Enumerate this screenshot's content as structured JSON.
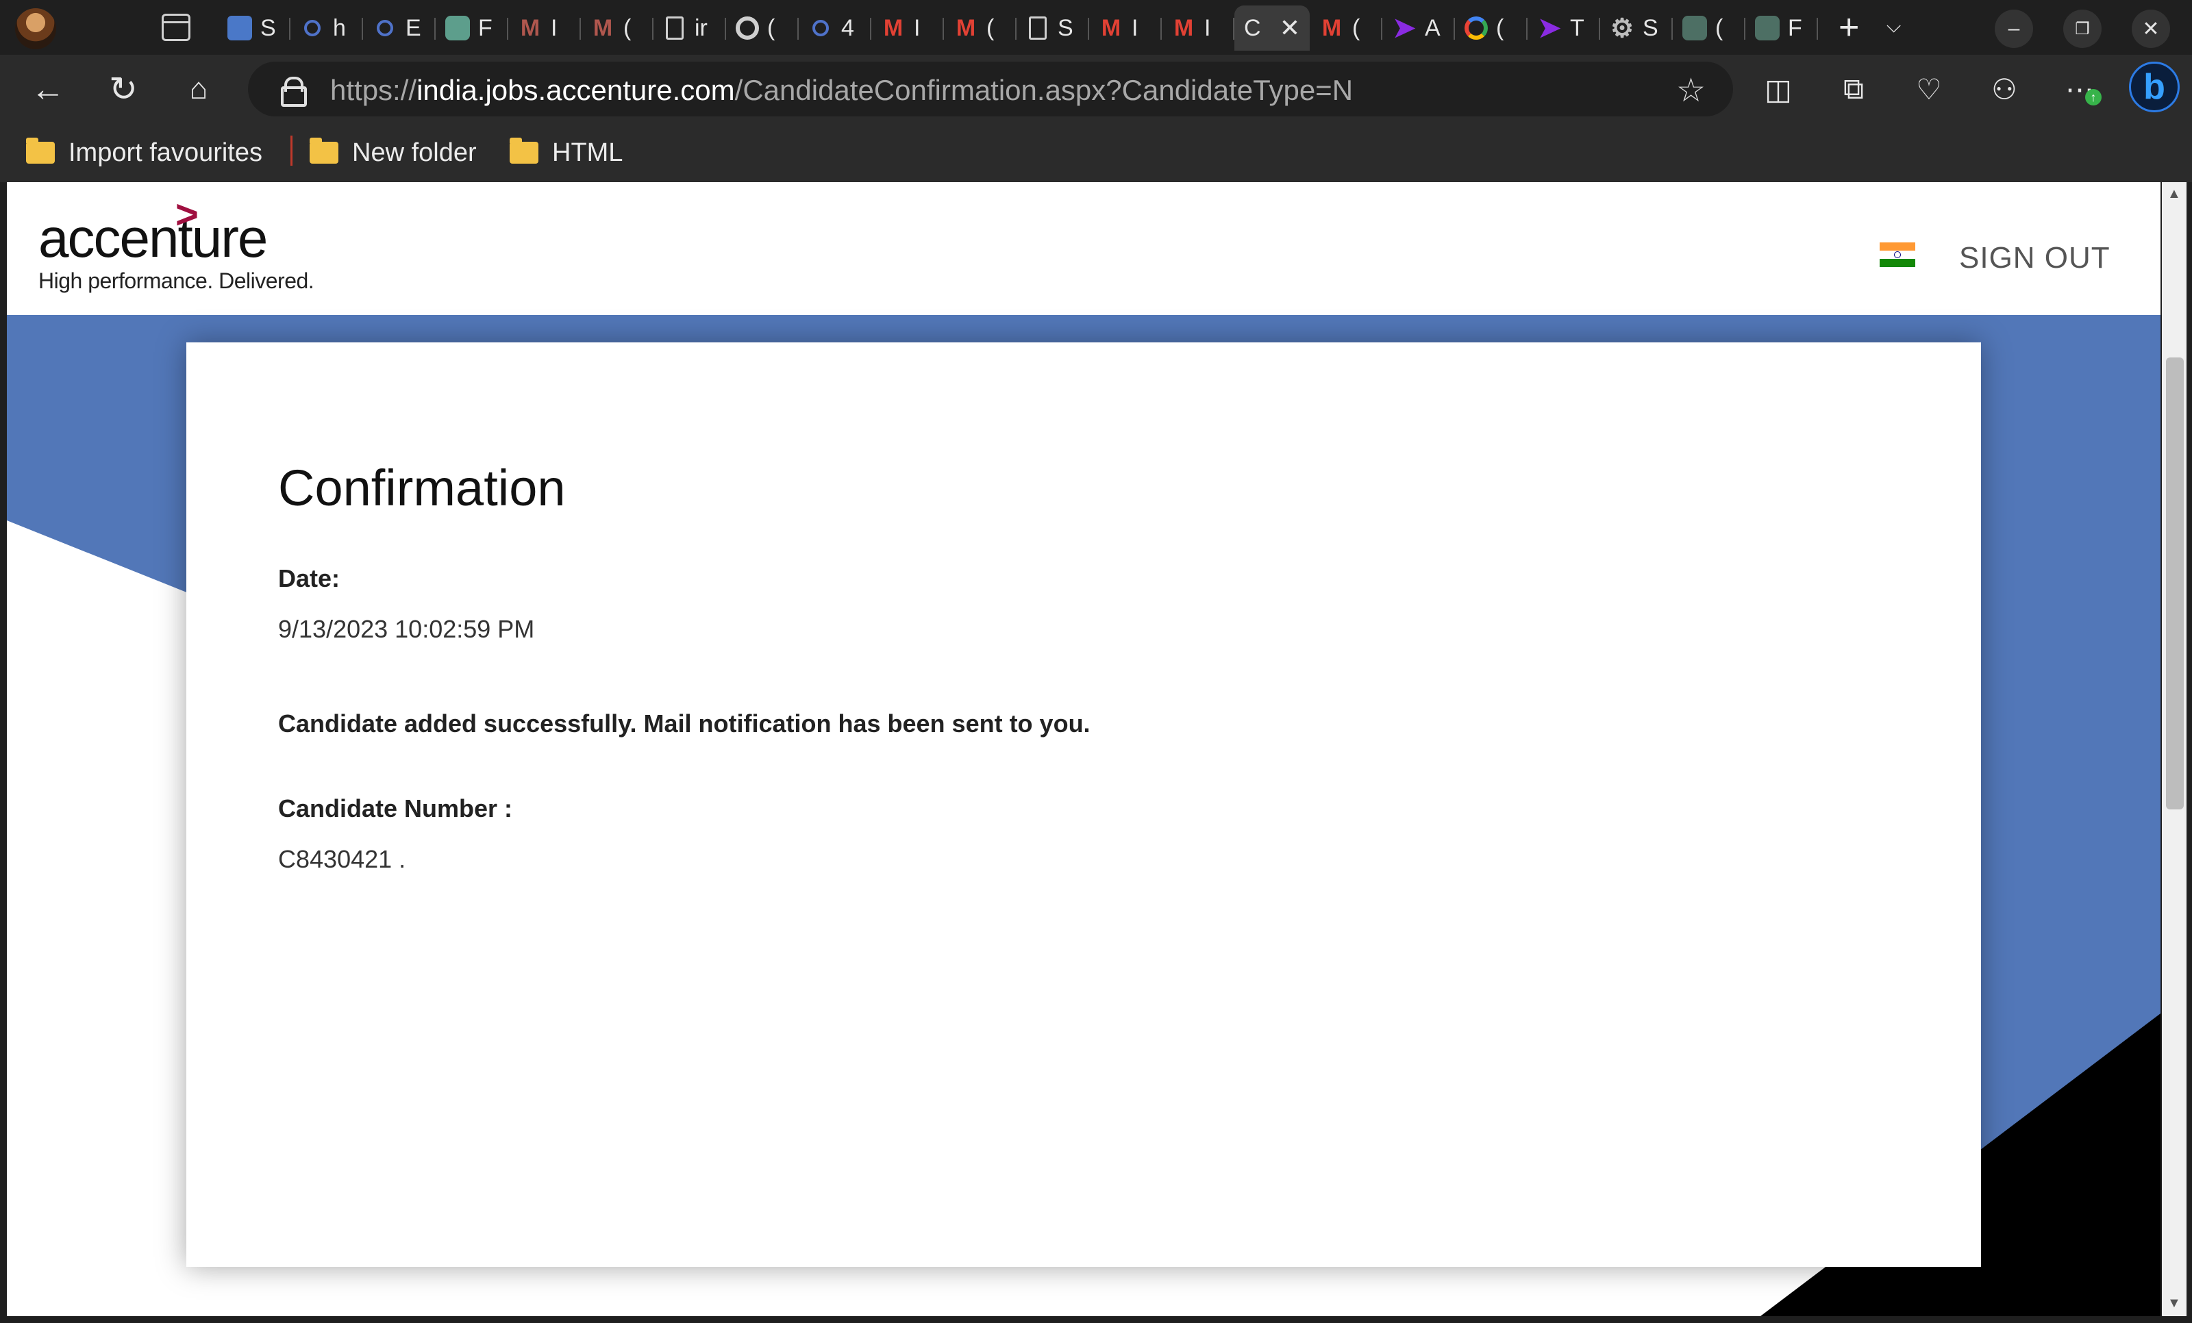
{
  "browser": {
    "tabs": [
      {
        "icon": "docs-icon",
        "label": "S"
      },
      {
        "icon": "search-icon",
        "label": "h"
      },
      {
        "icon": "search-icon",
        "label": "E"
      },
      {
        "icon": "chatgpt-icon",
        "label": "F"
      },
      {
        "icon": "gmail-icon",
        "label": "I"
      },
      {
        "icon": "gmail-icon",
        "label": "("
      },
      {
        "icon": "file-icon",
        "label": "ir"
      },
      {
        "icon": "google-icon",
        "label": "("
      },
      {
        "icon": "search-icon",
        "label": "4"
      },
      {
        "icon": "gmail-icon",
        "label": "I"
      },
      {
        "icon": "gmail-icon",
        "label": "("
      },
      {
        "icon": "file-icon",
        "label": "S"
      },
      {
        "icon": "gmail-icon",
        "label": "I"
      },
      {
        "icon": "gmail-icon",
        "label": "I"
      },
      {
        "icon": "none",
        "label": "C",
        "active": true
      },
      {
        "icon": "gmail-icon",
        "label": "("
      },
      {
        "icon": "arrow-icon",
        "label": "A"
      },
      {
        "icon": "google-icon",
        "label": "("
      },
      {
        "icon": "arrow-icon",
        "label": "T"
      },
      {
        "icon": "gear-icon",
        "label": "S"
      },
      {
        "icon": "chatgpt-icon",
        "label": "("
      },
      {
        "icon": "chatgpt-icon",
        "label": "F"
      }
    ],
    "url_scheme": "https://",
    "url_host": "india.jobs.accenture.com",
    "url_path": "/CandidateConfirmation.aspx?CandidateType=N",
    "favourites": [
      {
        "label": "Import favourites"
      },
      {
        "label": "New folder"
      },
      {
        "label": "HTML"
      }
    ]
  },
  "site": {
    "logo_text": "accenture",
    "logo_tagline": "High performance. Delivered.",
    "sign_out": "SIGN OUT"
  },
  "confirmation": {
    "title": "Confirmation",
    "date_label": "Date:",
    "date_value": "9/13/2023 10:02:59 PM",
    "message": "Candidate added successfully. Mail notification has been sent to you.",
    "candidate_label": "Candidate Number :",
    "candidate_value": "C8430421 ."
  },
  "colors": {
    "brand_blue": "#5277b8",
    "accent_chevron": "#a01040"
  }
}
